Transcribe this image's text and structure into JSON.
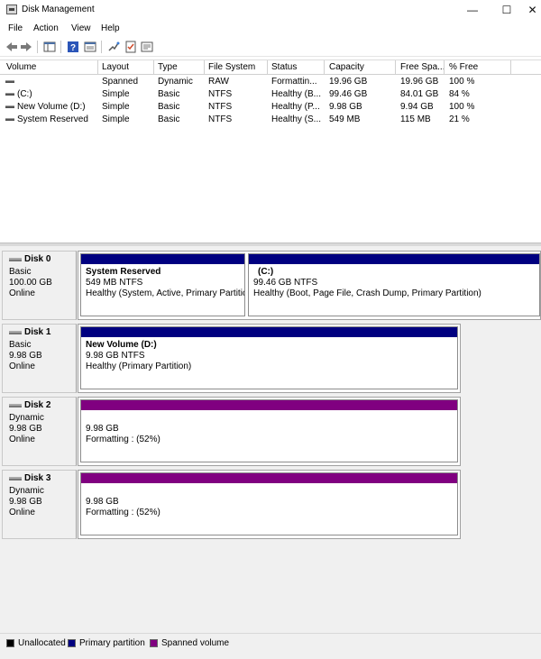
{
  "window": {
    "title": "Disk Management",
    "minimize": "—",
    "maximize": "☐",
    "close": "✕"
  },
  "menu": [
    "File",
    "Action",
    "View",
    "Help"
  ],
  "toolbar": [
    "back-icon",
    "forward-icon",
    "show-hide-console-tree-icon",
    "help-icon",
    "properties-icon",
    "connect-icon",
    "checklist-icon",
    "settings-icon"
  ],
  "volumes": {
    "columns": [
      "Volume",
      "Layout",
      "Type",
      "File System",
      "Status",
      "Capacity",
      "Free Spa...",
      "% Free"
    ],
    "rows": [
      {
        "volume": "",
        "layout": "Spanned",
        "type": "Dynamic",
        "fs": "RAW",
        "status": "Formattin...",
        "capacity": "19.96 GB",
        "free": "19.96 GB",
        "pct": "100 %"
      },
      {
        "volume": "(C:)",
        "layout": "Simple",
        "type": "Basic",
        "fs": "NTFS",
        "status": "Healthy (B...",
        "capacity": "99.46 GB",
        "free": "84.01 GB",
        "pct": "84 %"
      },
      {
        "volume": "New Volume (D:)",
        "layout": "Simple",
        "type": "Basic",
        "fs": "NTFS",
        "status": "Healthy (P...",
        "capacity": "9.98 GB",
        "free": "9.94 GB",
        "pct": "100 %"
      },
      {
        "volume": "System Reserved",
        "layout": "Simple",
        "type": "Basic",
        "fs": "NTFS",
        "status": "Healthy (S...",
        "capacity": "549 MB",
        "free": "115 MB",
        "pct": "21 %"
      }
    ]
  },
  "disks": [
    {
      "name": "Disk 0",
      "kind": "Basic",
      "size": "100.00 GB",
      "state": "Online",
      "partitions": [
        {
          "title": "System Reserved",
          "line2": "549 MB NTFS",
          "line3": "Healthy (System, Active, Primary Partitic"
        },
        {
          "title": "(C:)",
          "line2": "99.46 GB NTFS",
          "line3": "Healthy (Boot, Page File, Crash Dump, Primary Partition)"
        }
      ]
    },
    {
      "name": "Disk 1",
      "kind": "Basic",
      "size": "9.98 GB",
      "state": "Online",
      "partitions": [
        {
          "title": "New Volume  (D:)",
          "line2": "9.98 GB NTFS",
          "line3": "Healthy (Primary Partition)"
        }
      ]
    },
    {
      "name": "Disk 2",
      "kind": "Dynamic",
      "size": "9.98 GB",
      "state": "Online",
      "partitions": [
        {
          "title": "",
          "line2": "9.98 GB",
          "line3": "Formatting : (52%)"
        }
      ]
    },
    {
      "name": "Disk 3",
      "kind": "Dynamic",
      "size": "9.98 GB",
      "state": "Online",
      "partitions": [
        {
          "title": "",
          "line2": "9.98 GB",
          "line3": "Formatting : (52%)"
        }
      ]
    }
  ],
  "legend": [
    {
      "label": "Unallocated",
      "color": "#000000"
    },
    {
      "label": "Primary partition",
      "color": "#000080"
    },
    {
      "label": "Spanned volume",
      "color": "#800080"
    }
  ],
  "colors": {
    "primary": "#000080",
    "spanned": "#800080",
    "unallocated": "#000000"
  }
}
